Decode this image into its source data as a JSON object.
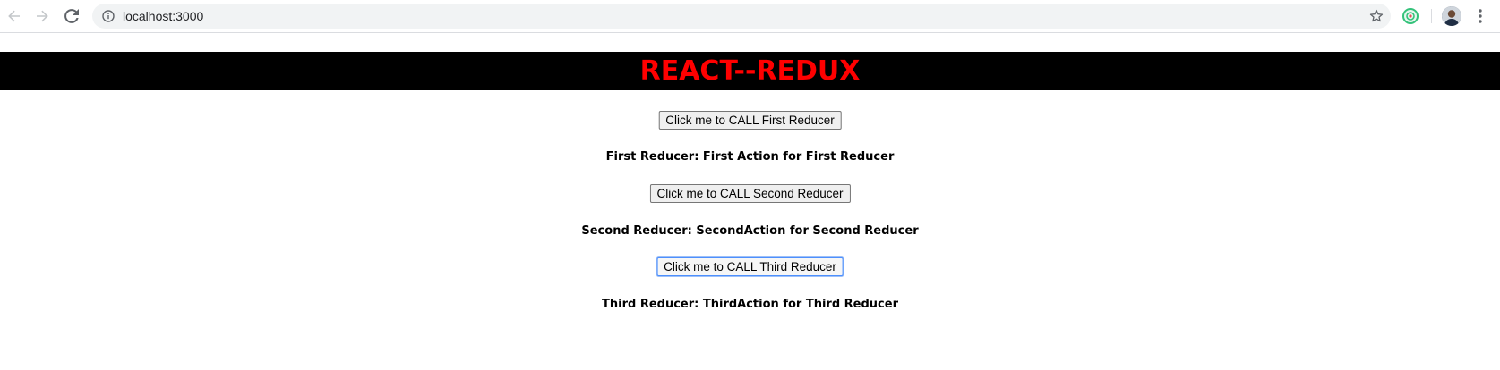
{
  "browser": {
    "url": "localhost:3000",
    "back_icon": "arrow-left-icon",
    "forward_icon": "arrow-right-icon",
    "reload_icon": "reload-icon",
    "site_info_icon": "info-icon",
    "bookmark_icon": "star-icon",
    "extension_icon": "extension-icon",
    "profile_icon": "avatar",
    "menu_icon": "kebab-menu-icon"
  },
  "page": {
    "title": "REACT--REDUX",
    "title_color": "#ff0000",
    "banner_color": "#000000",
    "sections": [
      {
        "button_label": "Click me to CALL First Reducer",
        "result_text": "First Reducer: First Action for First Reducer"
      },
      {
        "button_label": "Click me to CALL Second Reducer",
        "result_text": "Second Reducer: SecondAction for Second Reducer"
      },
      {
        "button_label": "Click me to CALL Third Reducer",
        "result_text": "Third Reducer: ThirdAction for Third Reducer",
        "focused": true
      }
    ]
  }
}
